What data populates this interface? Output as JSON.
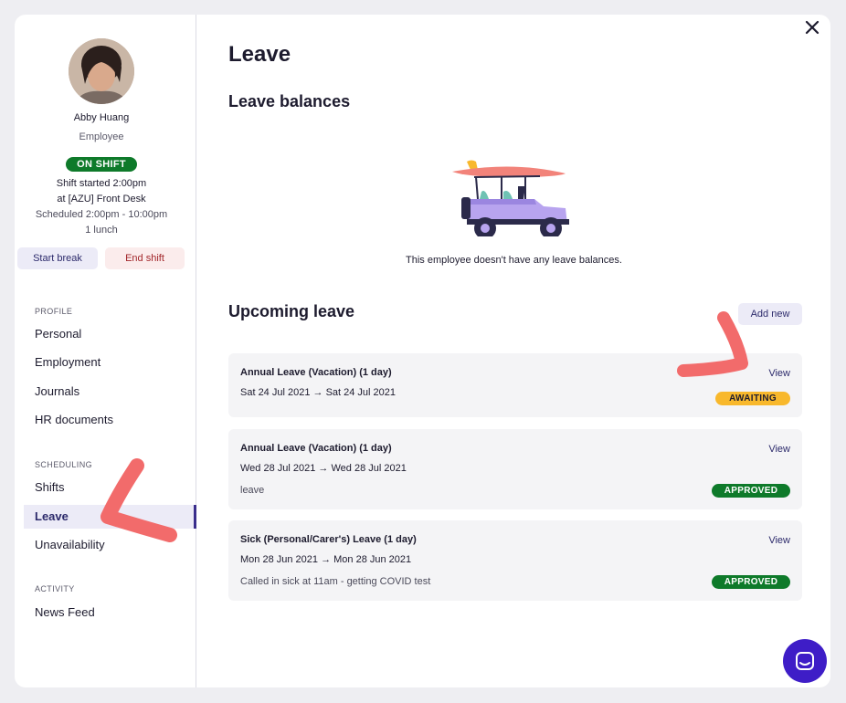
{
  "profile": {
    "name": "Abby Huang",
    "role": "Employee",
    "status_badge": "ON SHIFT",
    "shift_started": "Shift started 2:00pm",
    "location": "at [AZU] Front Desk",
    "scheduled": "Scheduled 2:00pm - 10:00pm",
    "breaks": "1 lunch",
    "start_break_label": "Start break",
    "end_shift_label": "End shift"
  },
  "nav": {
    "sections": [
      {
        "label": "PROFILE",
        "items": [
          "Personal",
          "Employment",
          "Journals",
          "HR documents"
        ]
      },
      {
        "label": "SCHEDULING",
        "items": [
          "Shifts",
          "Leave",
          "Unavailability"
        ]
      },
      {
        "label": "ACTIVITY",
        "items": [
          "News Feed"
        ]
      }
    ],
    "active": "Leave"
  },
  "main": {
    "title": "Leave",
    "balances_heading": "Leave balances",
    "balances_empty": "This employee doesn't have any leave balances.",
    "upcoming_heading": "Upcoming leave",
    "add_new_label": "Add new",
    "view_label": "View",
    "leave_items": [
      {
        "title": "Annual Leave (Vacation) (1 day)",
        "start": "Sat 24 Jul 2021",
        "end": "Sat 24 Jul 2021",
        "note": "",
        "status": "AWAITING"
      },
      {
        "title": "Annual Leave (Vacation) (1 day)",
        "start": "Wed 28 Jul 2021",
        "end": "Wed 28 Jul 2021",
        "note": "leave",
        "status": "APPROVED"
      },
      {
        "title": "Sick (Personal/Carer's) Leave (1 day)",
        "start": "Mon 28 Jun 2021",
        "end": "Mon 28 Jun 2021",
        "note": "Called in sick at 11am - getting COVID test",
        "status": "APPROVED"
      }
    ]
  },
  "colors": {
    "accent": "#2c2a6b",
    "approved": "#0e7a2a",
    "awaiting": "#f8b82c",
    "chat": "#3e1dc7",
    "annotation_arrow": "#f26b6b"
  },
  "icons": [
    "close-icon",
    "chat-icon",
    "jeep-illustration",
    "arrow-right-icon"
  ]
}
